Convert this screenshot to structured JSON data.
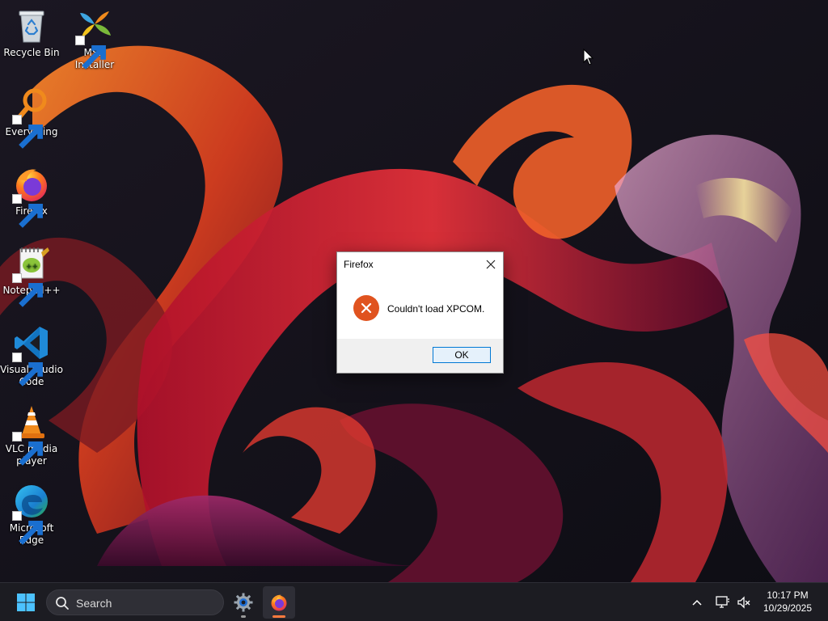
{
  "desktop": {
    "icons": [
      {
        "label": "Recycle Bin",
        "icon": "recycle-bin-icon"
      },
      {
        "label": "MSN Installer",
        "icon": "msn-icon"
      },
      {
        "label": "Everything",
        "icon": "everything-search-icon"
      },
      {
        "label": "Firefox",
        "icon": "firefox-icon"
      },
      {
        "label": "Notepad++",
        "icon": "notepad-plus-plus-icon"
      },
      {
        "label": "Visual Studio Code",
        "icon": "vscode-icon"
      },
      {
        "label": "VLC media player",
        "icon": "vlc-icon"
      },
      {
        "label": "Microsoft Edge",
        "icon": "edge-icon"
      }
    ]
  },
  "dialog": {
    "title": "Firefox",
    "message": "Couldn't load XPCOM.",
    "ok_label": "OK",
    "icon": "error-icon"
  },
  "taskbar": {
    "search_label": "Search",
    "pinned": [
      {
        "name": "Settings",
        "icon": "settings-gear-icon"
      },
      {
        "name": "Firefox",
        "icon": "firefox-icon",
        "active": true
      }
    ],
    "clock": {
      "time": "10:17 PM",
      "date": "10/29/2025"
    }
  },
  "colors": {
    "taskbar_bg": "#1c1c22",
    "dialog_button_border": "#0078d4",
    "error_icon": "#e0531f",
    "firefox_orange": "#ff7a3d"
  }
}
